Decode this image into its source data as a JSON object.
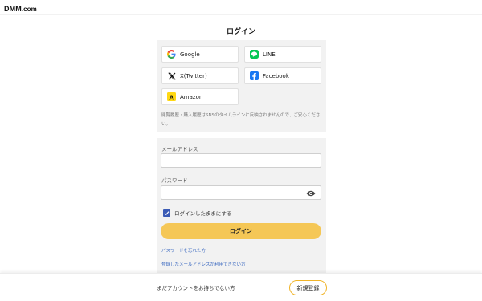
{
  "header": {
    "logo": "DMM.com",
    "logo_main": "DMM",
    "logo_suffix": ".com"
  },
  "page": {
    "title": "ログイン"
  },
  "sns": {
    "buttons": [
      {
        "label": "Google",
        "icon": "google-icon"
      },
      {
        "label": "LINE",
        "icon": "line-icon",
        "color": "#06c755"
      },
      {
        "label": "X(Twitter)",
        "icon": "x-icon"
      },
      {
        "label": "Facebook",
        "icon": "facebook-icon",
        "color": "#1877f2"
      },
      {
        "label": "Amazon",
        "icon": "amazon-icon",
        "color": "#ffd814"
      }
    ],
    "note": "閲覧履歴・購入履歴はSNSのタイムラインに反映されませんので、ご安心ください。"
  },
  "form": {
    "email_label": "メールアドレス",
    "email_value": "",
    "password_label": "パスワード",
    "password_value": "",
    "remember_label": "ログインしたままにする",
    "remember_checked": true,
    "login_button": "ログイン",
    "forgot_password_link": "パスワードを忘れた方",
    "email_unavailable_link": "登録したメールアドレスが利用できない方"
  },
  "footer": {
    "no_account_text": "まだアカウントをお持ちでない方",
    "signup_button": "新規登録"
  },
  "colors": {
    "accent": "#f5c756",
    "checkbox": "#3b5bb5",
    "link": "#3e6bc1",
    "signup_border": "#f0b429"
  }
}
